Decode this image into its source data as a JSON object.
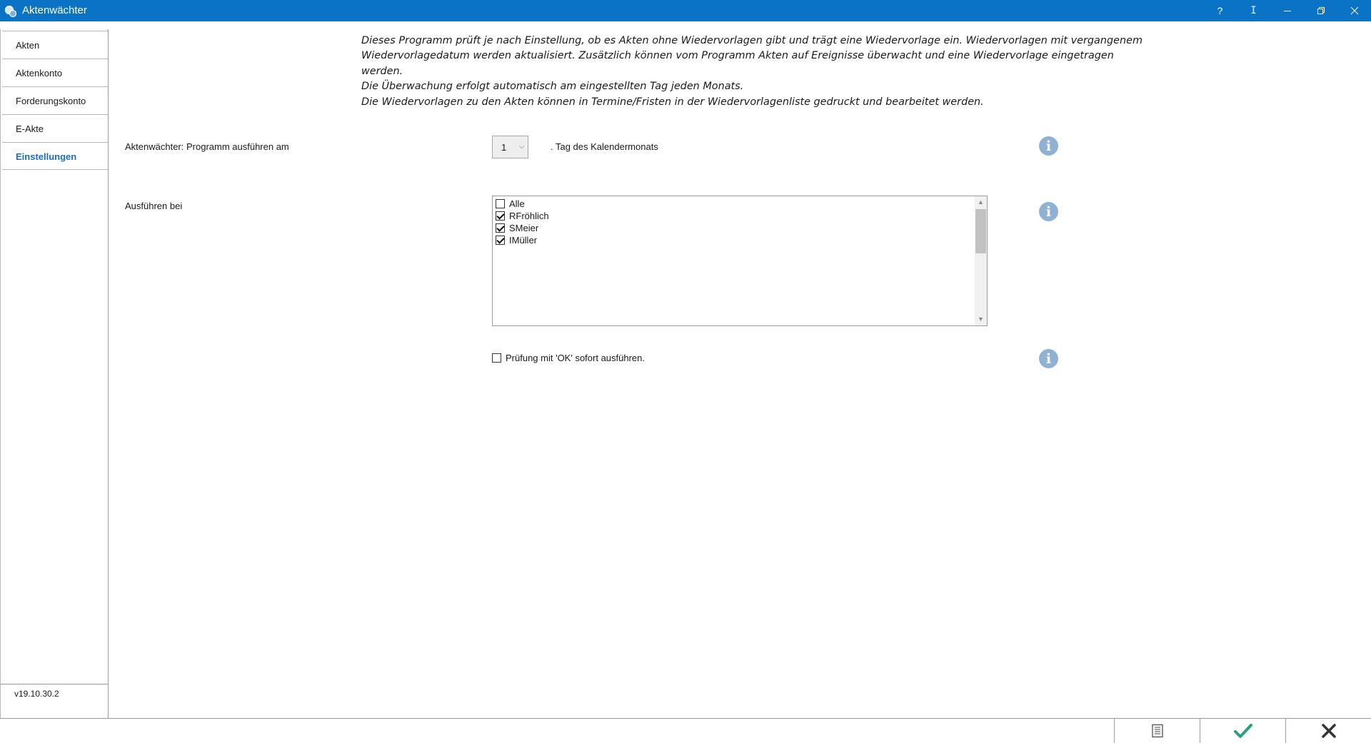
{
  "window": {
    "title": "Aktenwächter",
    "buttons": {
      "help": "?",
      "cursor": "I"
    }
  },
  "sidebar": {
    "items": [
      {
        "label": "Akten"
      },
      {
        "label": "Aktenkonto"
      },
      {
        "label": "Forderungskonto"
      },
      {
        "label": "E-Akte"
      },
      {
        "label": "Einstellungen",
        "active": true
      }
    ],
    "version": "v19.10.30.2"
  },
  "main": {
    "description": [
      "Dieses Programm prüft je nach Einstellung, ob es Akten ohne Wiedervorlagen gibt und trägt eine Wiedervorlage ein. Wiedervorlagen mit vergangenem",
      "Wiedervorlagedatum werden aktualisiert. Zusätzlich können vom Programm Akten auf Ereignisse überwacht und eine Wiedervorlage eingetragen werden.",
      "Die Überwachung erfolgt automatisch am eingestellten Tag jeden Monats.",
      "Die Wiedervorlagen zu den Akten können in Termine/Fristen in der Wiedervorlagenliste gedruckt und bearbeitet werden."
    ],
    "schedule": {
      "label": "Aktenwächter: Programm ausführen am",
      "day_value": "1",
      "suffix": ". Tag des Kalendermonats"
    },
    "run_for": {
      "label": "Ausführen bei",
      "users": [
        {
          "name": "Alle",
          "checked": false
        },
        {
          "name": "RFröhlich",
          "checked": true
        },
        {
          "name": "SMeier",
          "checked": true
        },
        {
          "name": "IMüller",
          "checked": true
        }
      ]
    },
    "run_now": {
      "label": "Prüfung mit 'OK' sofort ausführen.",
      "checked": false
    }
  },
  "colors": {
    "titlebar": "#0a73c6",
    "active_nav": "#1e6cc0",
    "info_icon": "#8fb2d3",
    "ok_check": "#2e9a8a"
  },
  "icons": {
    "footer": [
      "list-icon",
      "checkmark-icon",
      "close-x-icon"
    ],
    "info": "info-icon"
  }
}
